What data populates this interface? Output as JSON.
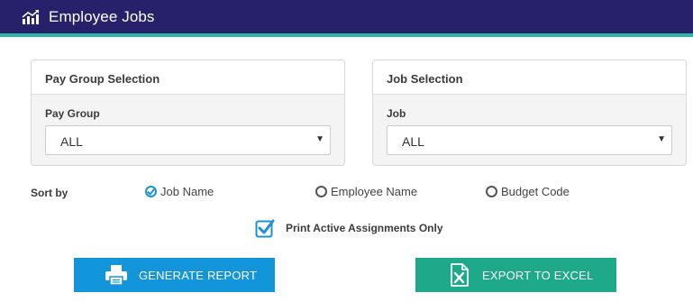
{
  "header": {
    "title": "Employee Jobs",
    "icon": "chart-trend-icon"
  },
  "pay_group_panel": {
    "title": "Pay Group Selection",
    "field_label": "Pay Group",
    "selected": "ALL"
  },
  "job_panel": {
    "title": "Job Selection",
    "field_label": "Job",
    "selected": "ALL"
  },
  "sort": {
    "label": "Sort by",
    "options": [
      {
        "label": "Job Name",
        "selected": true
      },
      {
        "label": "Employee Name",
        "selected": false
      },
      {
        "label": "Budget Code",
        "selected": false
      }
    ]
  },
  "active_only": {
    "label": "Print Active Assignments Only",
    "checked": true
  },
  "buttons": {
    "generate_report": "GENERATE REPORT",
    "export_excel": "EXPORT TO EXCEL"
  },
  "colors": {
    "header_bg": "#27216c",
    "header_accent": "#2bb3a5",
    "report_button": "#1395dc",
    "excel_button": "#1fa98b",
    "radio_selected": "#1e90d6"
  }
}
